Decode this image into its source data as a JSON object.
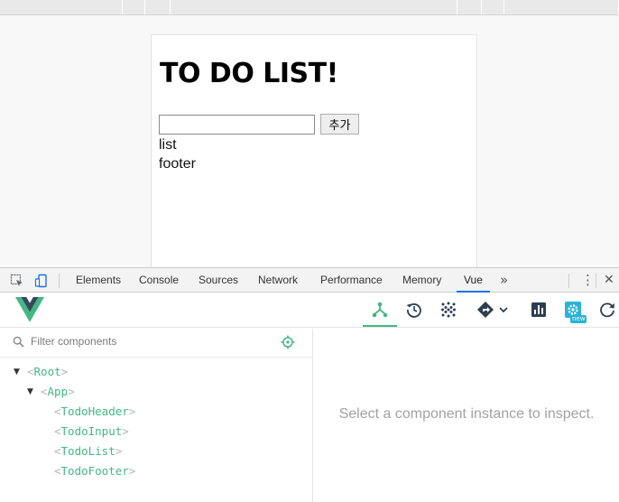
{
  "page": {
    "title": "TO DO LIST!",
    "input_value": "",
    "add_button_label": "추가",
    "list_text": "list",
    "footer_text": "footer"
  },
  "devtools": {
    "tabs": [
      {
        "label": "Elements"
      },
      {
        "label": "Console"
      },
      {
        "label": "Sources"
      },
      {
        "label": "Network"
      },
      {
        "label": "Performance"
      },
      {
        "label": "Memory"
      },
      {
        "label": "Vue"
      }
    ],
    "active_tab": "Vue",
    "more_tabs_label": "»",
    "menu_icon": "⋮",
    "close_icon": "✕"
  },
  "vue": {
    "toolbar_icons": [
      "components-icon",
      "history-icon",
      "vuex-icon",
      "routing-icon",
      "performance-icon",
      "settings-icon",
      "refresh-icon"
    ],
    "new_badge": "new",
    "filter_placeholder": "Filter components",
    "tree": [
      {
        "name": "Root",
        "expanded": true
      },
      {
        "name": "App",
        "expanded": true
      },
      {
        "name": "TodoHeader"
      },
      {
        "name": "TodoInput"
      },
      {
        "name": "TodoList"
      },
      {
        "name": "TodoFooter"
      }
    ],
    "inspect_message": "Select a component instance to inspect."
  },
  "colors": {
    "vue_green": "#42b883",
    "vue_dark": "#35495e",
    "devtools_blue": "#1a73e8",
    "badge_blue": "#2ab3d7"
  }
}
